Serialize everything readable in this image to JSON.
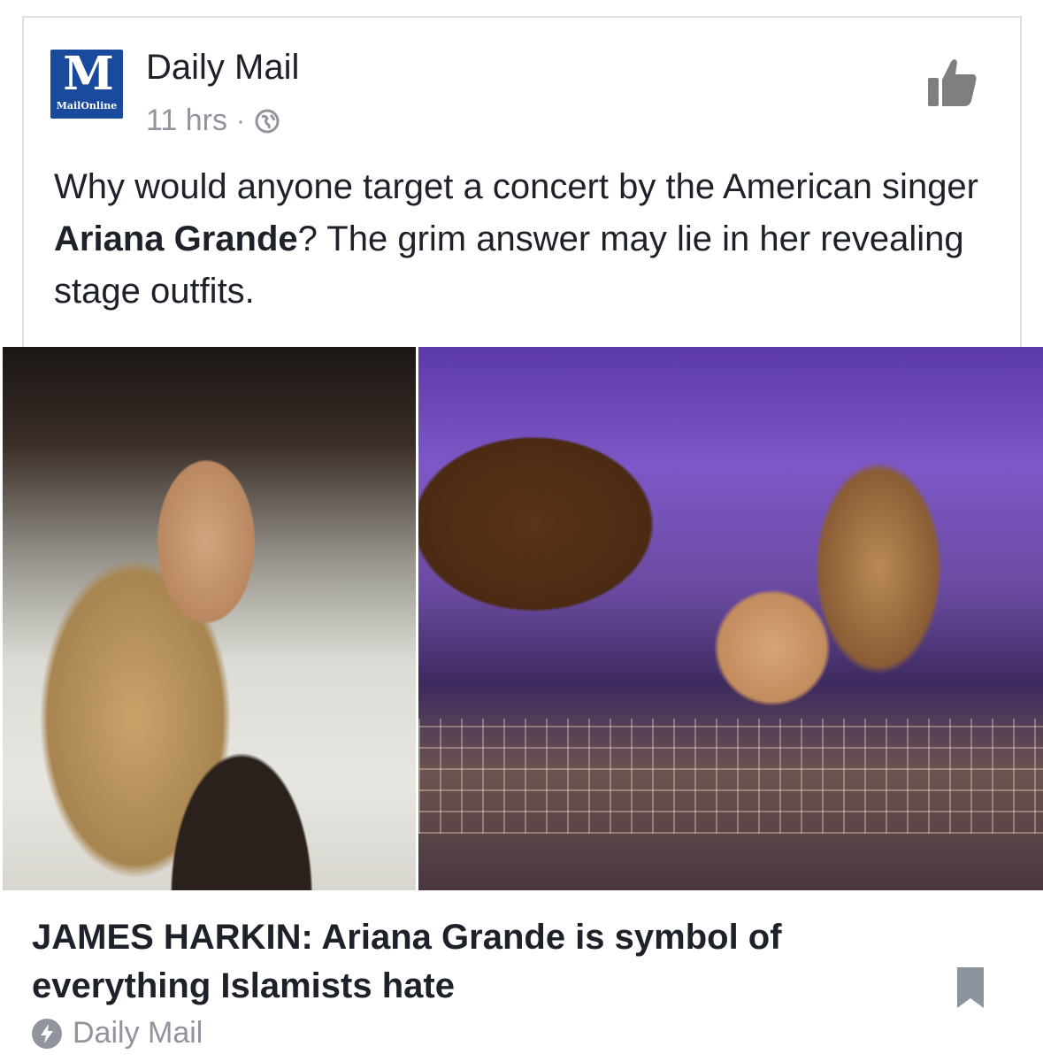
{
  "post": {
    "page_name": "Daily Mail",
    "logo_letter": "M",
    "logo_subtext": "MailOnline",
    "timestamp": "11 hrs",
    "separator": "·",
    "privacy_icon": "globe-icon",
    "status_before": "Why would anyone target a concert by the American singer ",
    "status_bold": "Ariana Grande",
    "status_after": "? The grim answer may lie in her revealing stage outfits."
  },
  "link": {
    "headline": "JAMES HARKIN: Ariana Grande is symbol of everything Islamists hate",
    "source_label": "Daily Mail",
    "source_icon": "instant-article-bolt-icon",
    "bookmark_icon": "bookmark-icon"
  },
  "actions": {
    "like_icon": "like-thumb-icon"
  },
  "colors": {
    "logo_blue": "#1a4a9c",
    "text": "#1d2129",
    "muted": "#90949c",
    "border": "#dddfe2"
  }
}
